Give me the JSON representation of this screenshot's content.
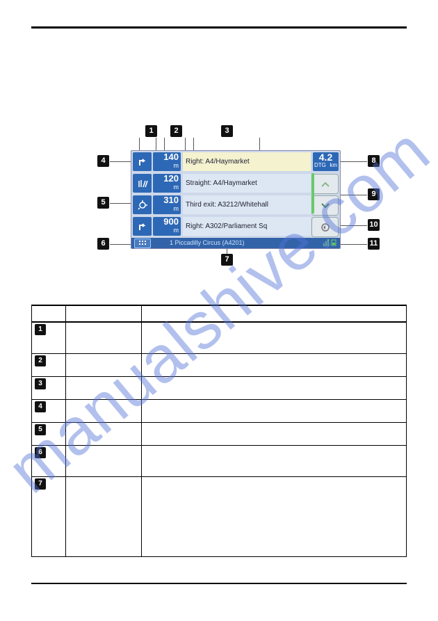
{
  "watermark_text": "manualshive.com",
  "callouts": {
    "n1": "1",
    "n2": "2",
    "n3": "3",
    "n4": "4",
    "n5": "5",
    "n6": "6",
    "n7": "7",
    "n8": "8",
    "n9": "9",
    "n10": "10",
    "n11": "11"
  },
  "nav_rows": [
    {
      "icon": "turn-right",
      "dist": "140",
      "unit": "m",
      "label": "Right: A4/Haymarket",
      "bg": "#f4f2cf"
    },
    {
      "icon": "lanes",
      "dist": "120",
      "unit": "m",
      "label": "Straight: A4/Haymarket",
      "bg": "#dde7f4"
    },
    {
      "icon": "roundabout",
      "dist": "310",
      "unit": "m",
      "label": "Third exit: A3212/Whitehall",
      "bg": "#dde7f4"
    },
    {
      "icon": "turn-right",
      "dist": "900",
      "unit": "m",
      "label": "Right: A302/Parliament Sq",
      "bg": "#dde7f4"
    }
  ],
  "dtg": {
    "value": "4.2",
    "label": "DTG",
    "unit": "km"
  },
  "status_bar_text": "1 Piccadilly Circus (A4201)",
  "table_rows": [
    {
      "num": "1",
      "name": "",
      "desc": ""
    },
    {
      "num": "2",
      "name": "",
      "desc": ""
    },
    {
      "num": "3",
      "name": "",
      "desc": ""
    },
    {
      "num": "4",
      "name": "",
      "desc": ""
    },
    {
      "num": "5",
      "name": "",
      "desc": ""
    },
    {
      "num": "6",
      "name": "",
      "desc": ""
    },
    {
      "num": "7",
      "name": "",
      "desc": ""
    }
  ]
}
